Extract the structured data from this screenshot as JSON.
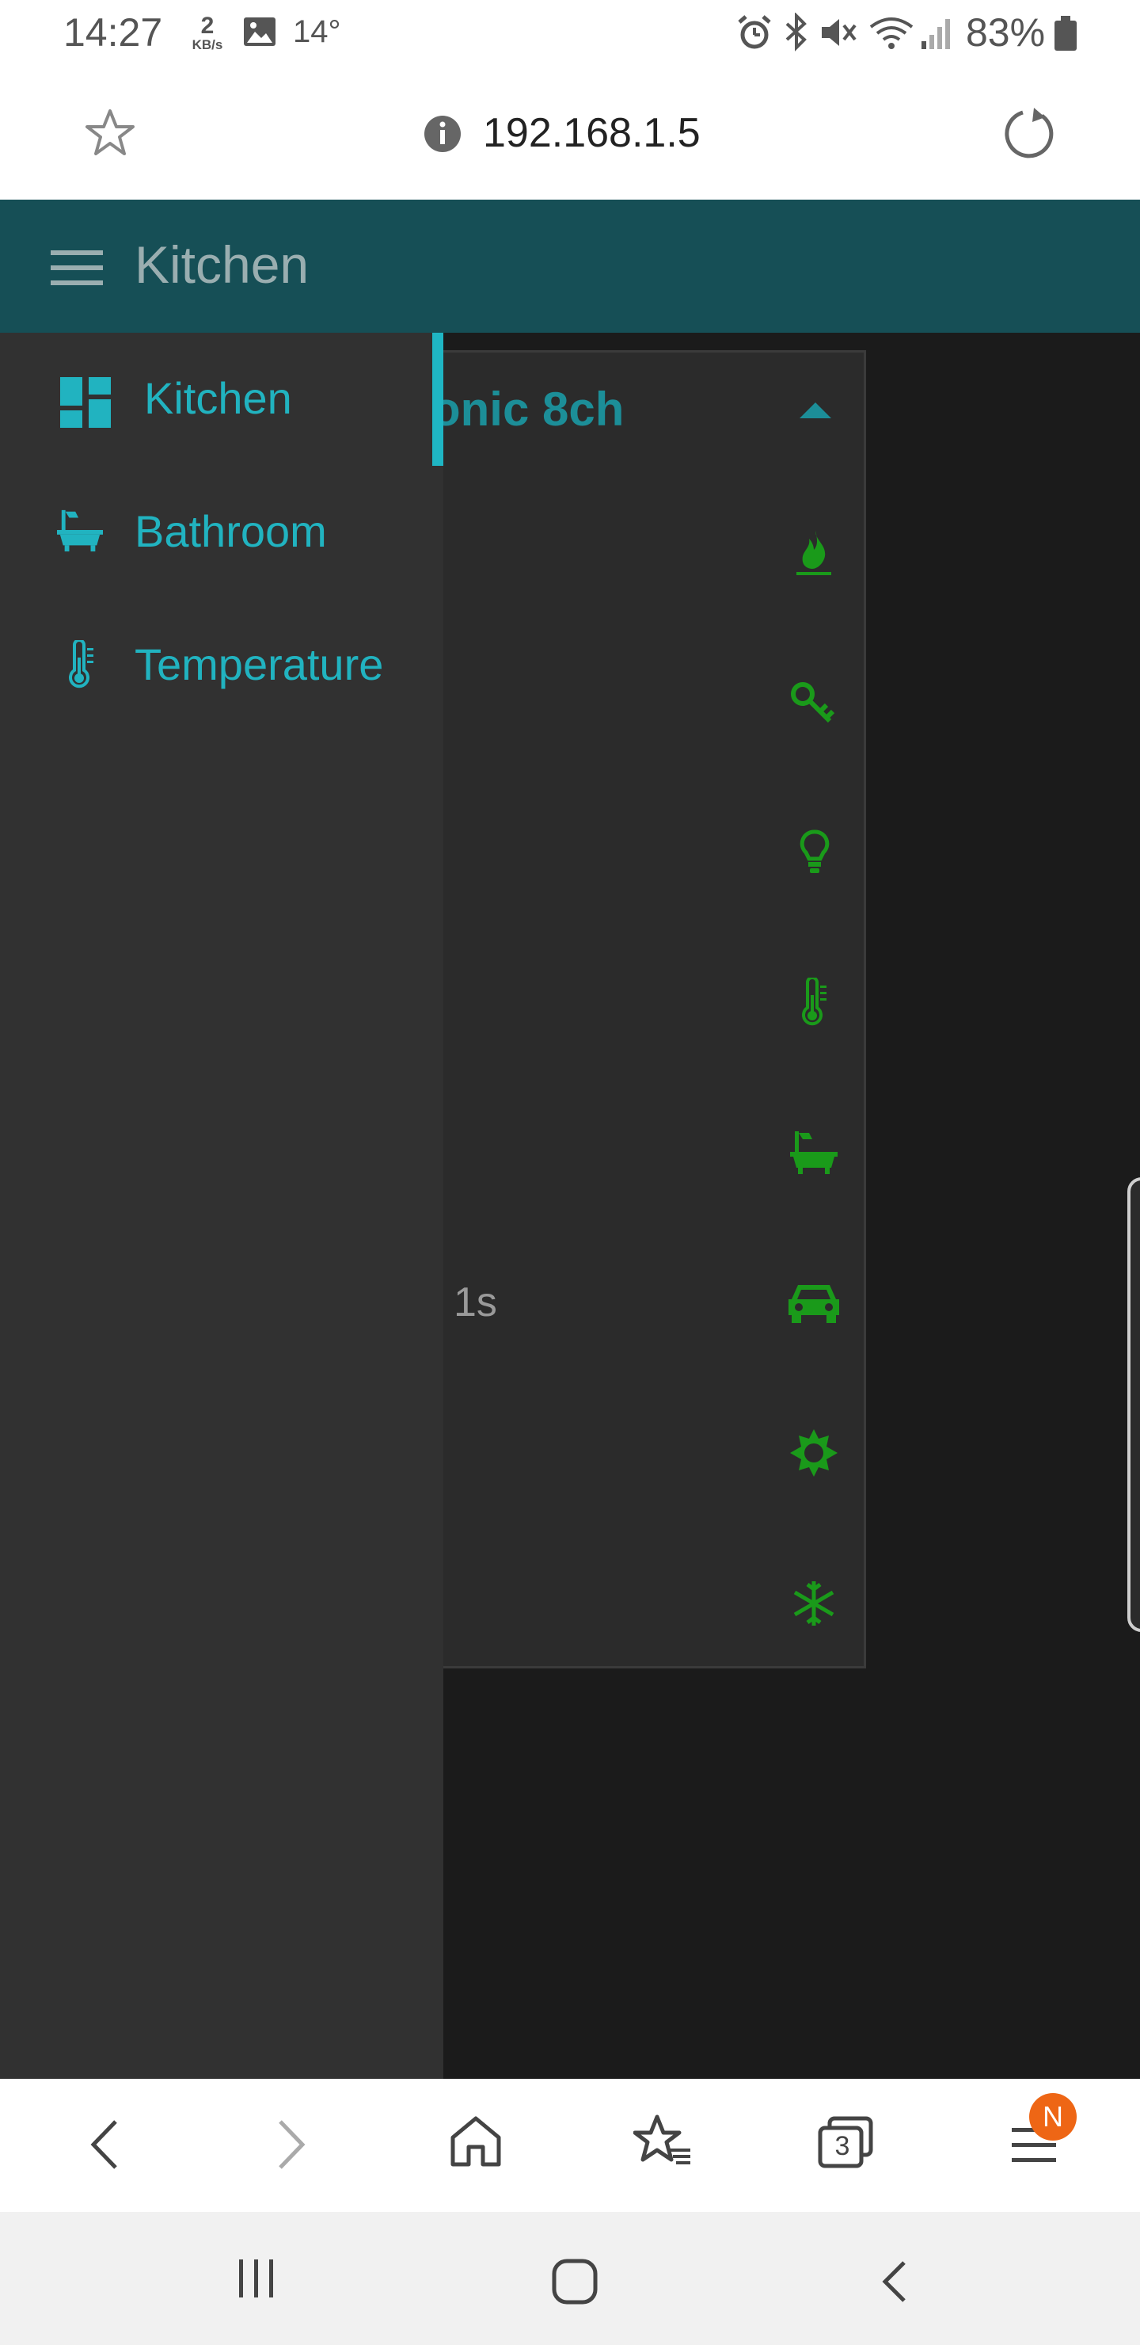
{
  "status_bar": {
    "time": "14:27",
    "data_rate_value": "2",
    "data_rate_unit": "KB/s",
    "temperature": "14°",
    "battery": "83%"
  },
  "browser": {
    "url": "192.168.1.5"
  },
  "header": {
    "title": "Kitchen",
    "menu_icon": "hamburger-icon"
  },
  "drawer": {
    "items": [
      {
        "label": "Kitchen",
        "icon": "dashboard-icon",
        "active": true
      },
      {
        "label": "Bathroom",
        "icon": "bathtub-icon",
        "active": false
      },
      {
        "label": "Temperature",
        "icon": "thermometer-icon",
        "active": false
      }
    ]
  },
  "card": {
    "title": "onic 8ch",
    "value_text": "1s",
    "row_icons": [
      "fire-icon",
      "key-icon",
      "bulb-icon",
      "thermometer-icon",
      "bathtub-icon",
      "car-icon",
      "sun-icon",
      "snowflake-icon"
    ]
  },
  "bottom_nav": {
    "tab_count": "3",
    "notification_badge": "N"
  },
  "colors": {
    "accent_teal": "#21b3c0",
    "header_bg": "#164f56",
    "icon_green": "#1a9a1a",
    "badge_orange": "#ee6615"
  }
}
